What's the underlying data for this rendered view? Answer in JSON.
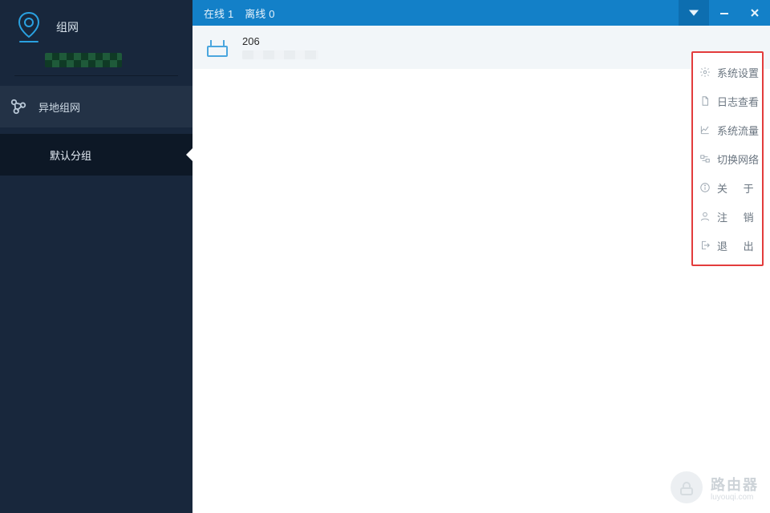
{
  "sidebar": {
    "title": "组网",
    "nav_label": "异地组网",
    "sub_group_label": "默认分组"
  },
  "titlebar": {
    "online_label": "在线",
    "online_count": "1",
    "offline_label": "离线",
    "offline_count": "0"
  },
  "device": {
    "name": "206"
  },
  "menu": {
    "items": [
      {
        "label": "系统设置",
        "spaced": false,
        "icon": "gear"
      },
      {
        "label": "日志查看",
        "spaced": false,
        "icon": "doc"
      },
      {
        "label": "系统流量",
        "spaced": false,
        "icon": "chart"
      },
      {
        "label": "切换网络",
        "spaced": false,
        "icon": "switch"
      },
      {
        "label": "关 于",
        "spaced": true,
        "icon": "info"
      },
      {
        "label": "注 销",
        "spaced": true,
        "icon": "user"
      },
      {
        "label": "退 出",
        "spaced": true,
        "icon": "exit"
      }
    ]
  },
  "watermark": {
    "title": "路由器",
    "subtitle": "luyouqi.com"
  }
}
